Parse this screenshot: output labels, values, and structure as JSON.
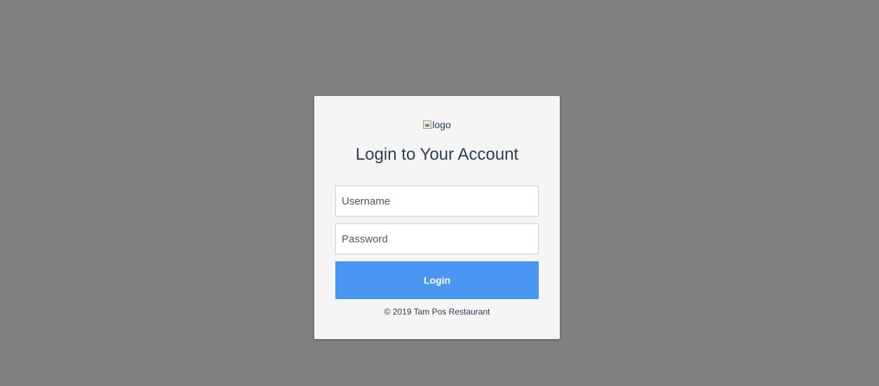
{
  "login": {
    "logo_alt": "logo",
    "title": "Login to Your Account",
    "username_placeholder": "Username",
    "password_placeholder": "Password",
    "button_label": "Login",
    "footer": "© 2019 Tam Pos Restaurant"
  },
  "icons": {
    "logo": "broken-image-icon"
  },
  "colors": {
    "background": "#808080",
    "card": "#f5f5f5",
    "button": "#4a96f3",
    "title_text": "#2c3e50"
  }
}
